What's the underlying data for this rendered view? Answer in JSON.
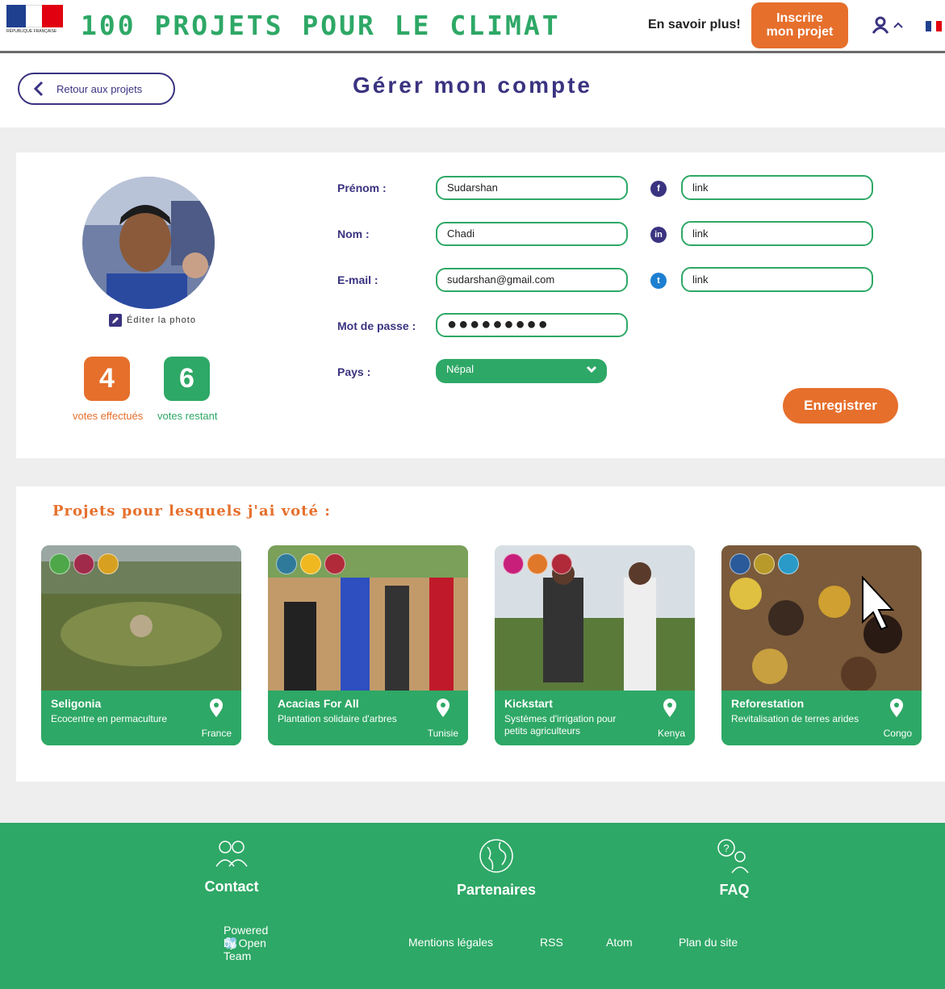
{
  "header": {
    "logo_text": "RÉPUBLIQUE FRANÇAISE",
    "site_title": "100 PROJETS POUR LE CLIMAT",
    "learn_more": "En savoir plus!",
    "register_line1": "Inscrire",
    "register_line2": "mon projet",
    "user_icon": "user-icon",
    "lang_icon": "french-flag-icon"
  },
  "nav": {
    "back_label": "Retour aux projets",
    "page_title": "Gérer mon compte"
  },
  "profile": {
    "edit_photo": "Éditer la photo",
    "votes_done": "4",
    "votes_done_label": "votes effectués",
    "votes_left": "6",
    "votes_left_label": "votes restant"
  },
  "form": {
    "prenom_label": "Prénom :",
    "prenom_value": "Sudarshan",
    "nom_label": "Nom :",
    "nom_value": "Chadi",
    "email_label": "E-mail :",
    "email_value": "sudarshan@gmail.com",
    "password_label": "Mot de passe :",
    "password_value": "●●●●●●●●●",
    "pays_label": "Pays :",
    "pays_value": "Népal",
    "facebook_value": "link",
    "linkedin_value": "link",
    "twitter_value": "link",
    "save_label": "Enregistrer"
  },
  "voted": {
    "title": "Projets pour lesquels j'ai voté :",
    "projects": [
      {
        "name": "Seligonia",
        "desc": "Ecocentre en permaculture",
        "country": "France"
      },
      {
        "name": "Acacias For All",
        "desc": "Plantation solidaire d'arbres",
        "country": "Tunisie"
      },
      {
        "name": "Kickstart",
        "desc": "Systèmes d'irrigation pour petits agriculteurs",
        "country": "Kenya"
      },
      {
        "name": "Reforestation",
        "desc": "Revitalisation de terres arides",
        "country": "Congo"
      }
    ]
  },
  "footer": {
    "contact": "Contact",
    "partners": "Partenaires",
    "faq": "FAQ",
    "powered": "Powered by Open Team",
    "legal": "Mentions légales",
    "rss": "RSS",
    "atom": "Atom",
    "sitemap": "Plan du site"
  },
  "colors": {
    "green": "#2ea866",
    "orange": "#e66f2c",
    "navy": "#3a3380"
  }
}
